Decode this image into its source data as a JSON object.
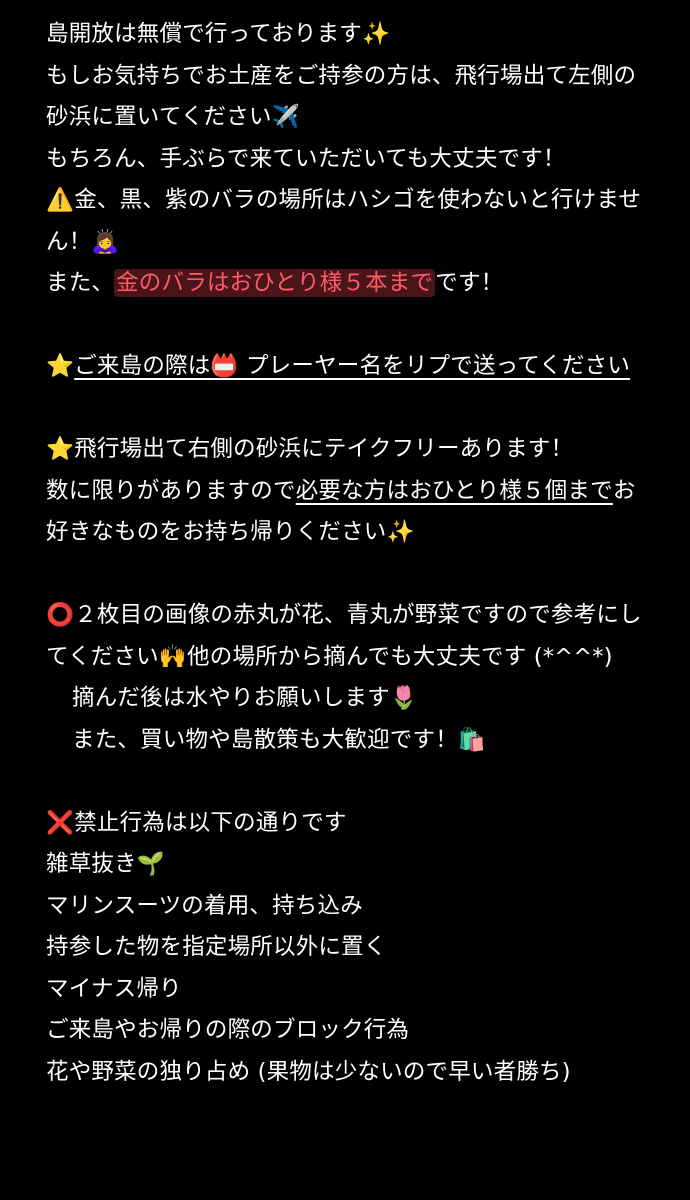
{
  "colors": {
    "background": "#000000",
    "text": "#ffffff",
    "highlight_bg": "#4a1518",
    "highlight_text": "#ff5a6a"
  },
  "block1": {
    "line1": "島開放は無償で行っております✨",
    "line2": "もしお気持ちでお土産をご持参の方は、飛行場出て左側の砂浜に置いてください✈️",
    "line3": "もちろん、手ぶらで来ていただいても大丈夫です！",
    "line4": "⚠️金、黒、紫のバラの場所はハシゴを使わないと行けません！🙇‍♀️",
    "line5_prefix": "また、",
    "line5_highlight": "金のバラはおひとり様５本まで",
    "line5_suffix": "です！"
  },
  "block2": {
    "star": "⭐️",
    "underlined": "ご来島の際は📛 プレーヤー名をリプで送ってください"
  },
  "block3": {
    "line1": "⭐️飛行場出て右側の砂浜にテイクフリーあります！",
    "line2_prefix": "数に限りがありますので",
    "line2_underlined": "必要な方はおひとり様５個まで",
    "line2_suffix": "お好きなものをお持ち帰りください✨"
  },
  "block4": {
    "line1": "⭕️２枚目の画像の赤丸が花、青丸が野菜ですので参考にしてください🙌他の場所から摘んでも大丈夫です (*^^*)",
    "line2": "摘んだ後は水やりお願いします🌷",
    "line3": "また、買い物や島散策も大歓迎です！🛍️"
  },
  "block5": {
    "heading": "❌禁止行為は以下の通りです",
    "items": [
      "雑草抜き🌱",
      "マリンスーツの着用、持ち込み",
      "持参した物を指定場所以外に置く",
      "マイナス帰り",
      "ご来島やお帰りの際のブロック行為",
      "花や野菜の独り占め (果物は少ないので早い者勝ち)"
    ]
  }
}
